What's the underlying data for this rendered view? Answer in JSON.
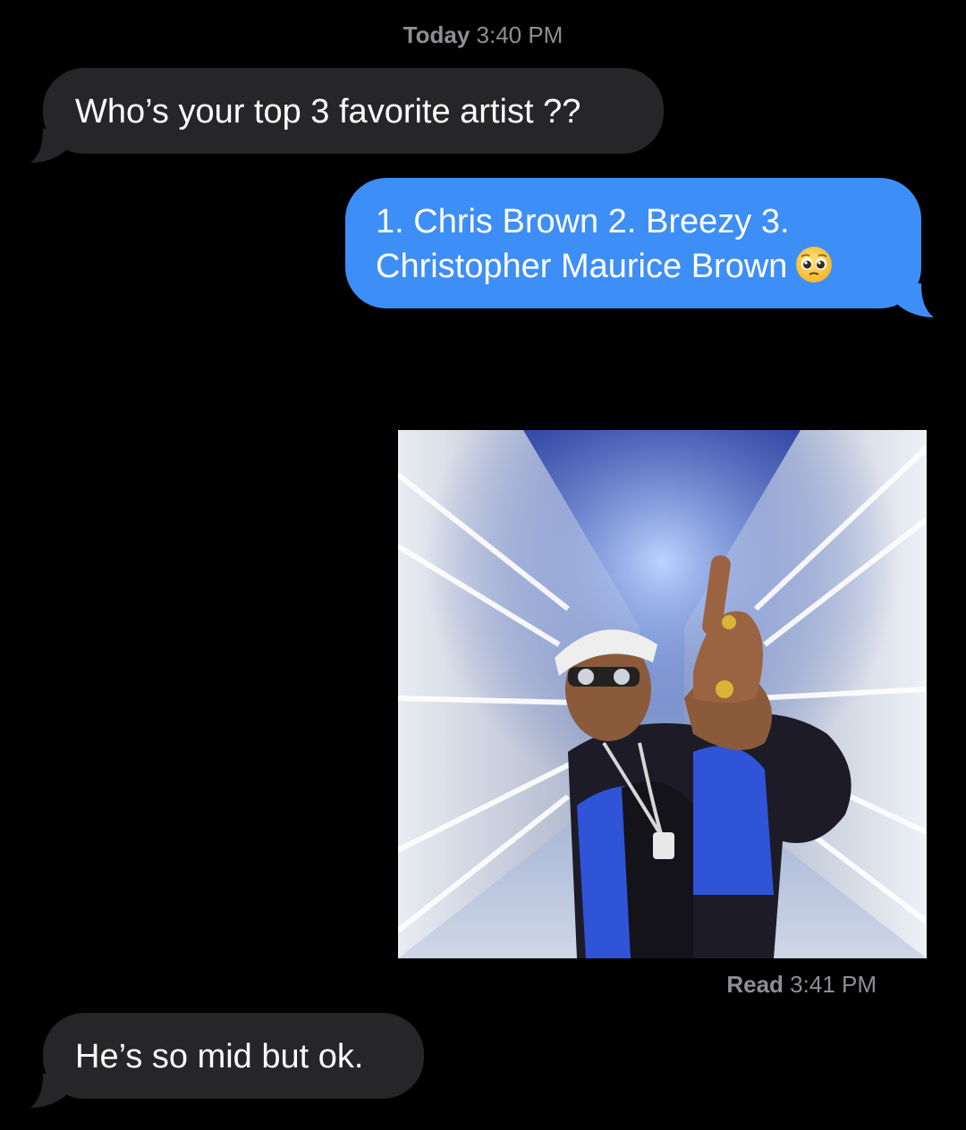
{
  "thread": {
    "timestamp_day": "Today",
    "timestamp_time": "3:40 PM",
    "messages": [
      {
        "direction": "incoming",
        "text": "Who’s your top 3 favorite artist ??"
      },
      {
        "direction": "outgoing",
        "text": "1. Chris Brown 2. Breezy 3. Christopher Maurice Brown",
        "emoji": "pleading-face-emoji"
      },
      {
        "direction": "outgoing",
        "type": "image",
        "content": "gif-image"
      },
      {
        "direction": "incoming",
        "text": "He’s so mid but ok."
      }
    ],
    "read_label": "Read",
    "read_time": "3:41 PM"
  },
  "colors": {
    "background": "#000000",
    "incoming_bubble": "#262628",
    "outgoing_bubble": "#3e8ef7",
    "meta_text": "#8e8e93"
  }
}
